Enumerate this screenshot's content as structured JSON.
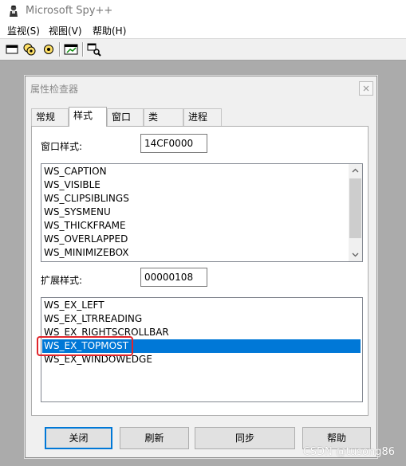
{
  "app": {
    "title": "Microsoft Spy++"
  },
  "menubar": {
    "items": [
      "监视(S)",
      "视图(V)",
      "帮助(H)"
    ]
  },
  "toolbar": {
    "buttons": [
      "windows-icon",
      "processes-icon",
      "threads-icon",
      "messages-icon",
      "find-window-icon"
    ]
  },
  "dialog": {
    "title": "属性检查器",
    "tabs": [
      "常规",
      "样式",
      "窗口",
      "类",
      "进程"
    ],
    "active_tab": "样式",
    "window_style": {
      "label": "窗口样式:",
      "value": "14CF0000",
      "items": [
        "WS_CAPTION",
        "WS_VISIBLE",
        "WS_CLIPSIBLINGS",
        "WS_SYSMENU",
        "WS_THICKFRAME",
        "WS_OVERLAPPED",
        "WS_MINIMIZEBOX"
      ]
    },
    "ex_style": {
      "label": "扩展样式:",
      "value": "00000108",
      "items": [
        "WS_EX_LEFT",
        "WS_EX_LTRREADING",
        "WS_EX_RIGHTSCROLLBAR",
        "WS_EX_TOPMOST",
        "WS_EX_WINDOWEDGE"
      ],
      "selected": "WS_EX_TOPMOST"
    },
    "buttons": {
      "close": "关闭",
      "refresh": "刷新",
      "sync": "同步",
      "help": "帮助"
    }
  },
  "watermark": "CSDN @tusong86",
  "colors": {
    "selection": "#0078d7",
    "annotation": "#e0252b"
  }
}
